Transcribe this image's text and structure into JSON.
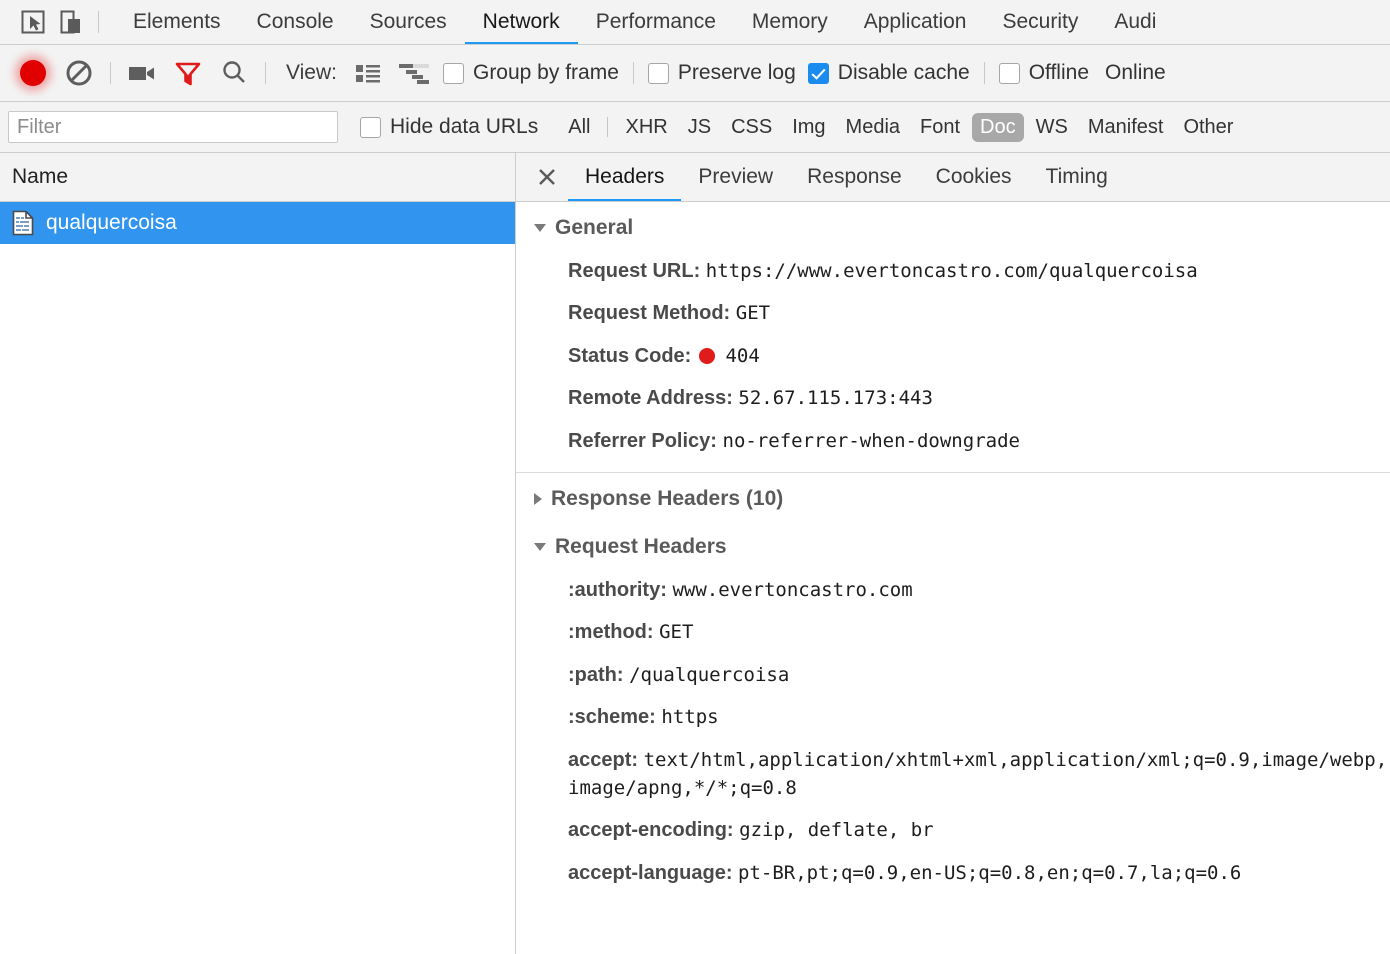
{
  "toolbar_icons": {
    "inspect": "inspect-element-icon",
    "device": "device-toolbar-icon"
  },
  "tabs": [
    {
      "label": "Elements",
      "active": false
    },
    {
      "label": "Console",
      "active": false
    },
    {
      "label": "Sources",
      "active": false
    },
    {
      "label": "Network",
      "active": true
    },
    {
      "label": "Performance",
      "active": false
    },
    {
      "label": "Memory",
      "active": false
    },
    {
      "label": "Application",
      "active": false
    },
    {
      "label": "Security",
      "active": false
    },
    {
      "label": "Audi",
      "active": false
    }
  ],
  "network_toolbar": {
    "record_title": "record-button",
    "clear_title": "clear-button",
    "screenshots_title": "capture-screenshots-button",
    "filter_title": "filter-toggle-button",
    "search_title": "search-button",
    "view_label": "View:",
    "view_list_title": "list-view-button",
    "view_waterfall_title": "waterfall-view-button",
    "group_by_frame": {
      "label": "Group by frame",
      "checked": false
    },
    "preserve_log": {
      "label": "Preserve log",
      "checked": false
    },
    "disable_cache": {
      "label": "Disable cache",
      "checked": true
    },
    "offline": {
      "label": "Offline",
      "checked": false
    },
    "online_label": "Online"
  },
  "filter_bar": {
    "input_value": "",
    "input_placeholder": "Filter",
    "hide_data_urls": {
      "label": "Hide data URLs",
      "checked": false
    },
    "types": [
      {
        "label": "All",
        "active": false
      },
      {
        "label": "XHR",
        "active": false
      },
      {
        "label": "JS",
        "active": false
      },
      {
        "label": "CSS",
        "active": false
      },
      {
        "label": "Img",
        "active": false
      },
      {
        "label": "Media",
        "active": false
      },
      {
        "label": "Font",
        "active": false
      },
      {
        "label": "Doc",
        "active": true
      },
      {
        "label": "WS",
        "active": false
      },
      {
        "label": "Manifest",
        "active": false
      },
      {
        "label": "Other",
        "active": false
      }
    ]
  },
  "request_list": {
    "column_header": "Name",
    "rows": [
      {
        "name": "qualquercoisa",
        "icon": "document-icon",
        "selected": true
      }
    ]
  },
  "details": {
    "close_label": "×",
    "tabs": [
      {
        "label": "Headers",
        "active": true
      },
      {
        "label": "Preview",
        "active": false
      },
      {
        "label": "Response",
        "active": false
      },
      {
        "label": "Cookies",
        "active": false
      },
      {
        "label": "Timing",
        "active": false
      }
    ],
    "general": {
      "title": "General",
      "expanded": true,
      "rows": [
        {
          "key": "Request URL:",
          "value": "https://www.evertoncastro.com/qualquercoisa"
        },
        {
          "key": "Request Method:",
          "value": "GET"
        },
        {
          "key": "Status Code:",
          "value": "404",
          "status_dot": true,
          "status_color": "#e01b1b"
        },
        {
          "key": "Remote Address:",
          "value": "52.67.115.173:443"
        },
        {
          "key": "Referrer Policy:",
          "value": "no-referrer-when-downgrade"
        }
      ]
    },
    "response_headers": {
      "title": "Response Headers (10)",
      "expanded": false
    },
    "request_headers": {
      "title": "Request Headers",
      "expanded": true,
      "rows": [
        {
          "key": ":authority:",
          "value": "www.evertoncastro.com"
        },
        {
          "key": ":method:",
          "value": "GET"
        },
        {
          "key": ":path:",
          "value": "/qualquercoisa"
        },
        {
          "key": ":scheme:",
          "value": "https"
        },
        {
          "key": "accept:",
          "value": "text/html,application/xhtml+xml,application/xml;q=0.9,image/webp,image/apng,*/*;q=0.8"
        },
        {
          "key": "accept-encoding:",
          "value": "gzip, deflate, br"
        },
        {
          "key": "accept-language:",
          "value": "pt-BR,pt;q=0.9,en-US;q=0.8,en;q=0.7,la;q=0.6"
        }
      ]
    }
  },
  "colors": {
    "accent_blue": "#1a9af5",
    "selection_blue": "#3194ee",
    "record_red": "#e00000",
    "status_red": "#e01b1b",
    "toolbar_bg": "#f3f3f3"
  }
}
